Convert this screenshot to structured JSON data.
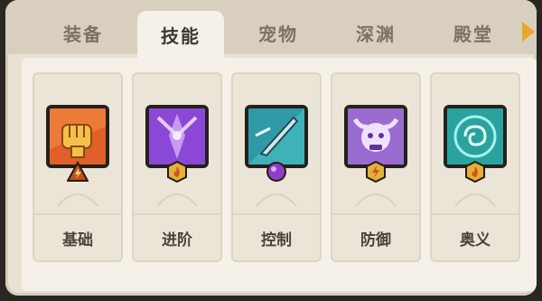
{
  "tabs": [
    {
      "label": "装备",
      "active": false
    },
    {
      "label": "技能",
      "active": true
    },
    {
      "label": "宠物",
      "active": false
    },
    {
      "label": "深渊",
      "active": false
    },
    {
      "label": "殿堂",
      "active": false
    }
  ],
  "skills": [
    {
      "label": "基础",
      "icon": "fist-icon",
      "badge": "lightning-badge",
      "bg": "#e0602a"
    },
    {
      "label": "进阶",
      "icon": "purple-energy-icon",
      "badge": "fire-coin-badge",
      "bg": "#8b48d6"
    },
    {
      "label": "控制",
      "icon": "blade-icon",
      "badge": "purple-orb-badge",
      "bg": "#2f9aa6"
    },
    {
      "label": "防御",
      "icon": "bull-skull-icon",
      "badge": "lightning-coin-badge",
      "bg": "#9a6bd0"
    },
    {
      "label": "奥义",
      "icon": "rune-icon",
      "badge": "fire-coin-badge",
      "bg": "#2aa3a0"
    }
  ],
  "colors": {
    "accent": "#e7a630",
    "active_tab_bg": "#f5f1e8",
    "panel_bg": "#e9e2d4"
  }
}
